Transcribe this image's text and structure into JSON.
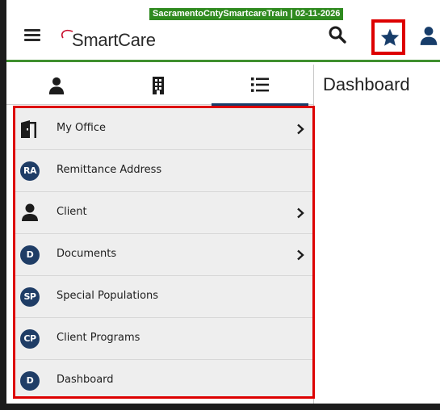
{
  "app": {
    "environment_banner": "SacramentoCntySmartcareTrain | 02-11-2026",
    "logo_text": "SmartCare"
  },
  "header_icons": [
    "menu-icon",
    "search-icon",
    "star-icon",
    "user-icon"
  ],
  "tabs": [
    {
      "icon": "person-icon",
      "active": false
    },
    {
      "icon": "building-icon",
      "active": false
    },
    {
      "icon": "list-icon",
      "active": true
    }
  ],
  "content": {
    "title": "Dashboard"
  },
  "menu": {
    "items": [
      {
        "label": "My Office",
        "icon": "door-icon",
        "badge": "",
        "has_submenu": true
      },
      {
        "label": "Remittance Address",
        "icon": "",
        "badge": "RA",
        "has_submenu": false
      },
      {
        "label": "Client",
        "icon": "person-icon",
        "badge": "",
        "has_submenu": true
      },
      {
        "label": "Documents",
        "icon": "",
        "badge": "D",
        "has_submenu": true
      },
      {
        "label": "Special Populations",
        "icon": "",
        "badge": "SP",
        "has_submenu": false
      },
      {
        "label": "Client Programs",
        "icon": "",
        "badge": "CP",
        "has_submenu": false
      },
      {
        "label": "Dashboard",
        "icon": "",
        "badge": "D",
        "has_submenu": false
      }
    ]
  },
  "colors": {
    "highlight": "#dd0000",
    "env_banner": "#2f8a1f",
    "header_rule": "#3f8f2e",
    "badge": "#1f3d66",
    "menu_bg": "#eeeeee"
  }
}
